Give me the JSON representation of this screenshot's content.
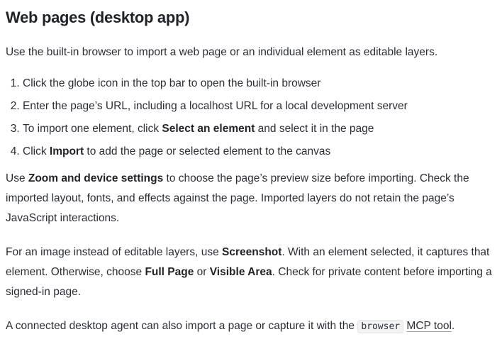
{
  "heading": "Web pages (desktop app)",
  "intro": "Use the built-in browser to import a web page or an individual element as editable layers.",
  "steps": [
    {
      "text": "Click the globe icon in the top bar to open the built-in browser"
    },
    {
      "text": "Enter the page’s URL, including a localhost URL for a local development server"
    },
    {
      "before": "To import one element, click ",
      "bold": "Select an element",
      "after": " and select it in the page"
    },
    {
      "before": "Click ",
      "bold": "Import",
      "after": " to add the page or selected element to the canvas"
    }
  ],
  "zoom_para": {
    "before": "Use ",
    "bold": "Zoom and device settings",
    "after": " to choose the page’s preview size before importing. Check the imported layout, fonts, and effects against the page. Imported layers do not retain the page’s JavaScript interactions."
  },
  "screenshot_para": {
    "t1": "For an image instead of editable layers, use ",
    "b1": "Screenshot",
    "t2": ". With an element selected, it captures that element. Otherwise, choose ",
    "b2": "Full Page",
    "t3": " or ",
    "b3": "Visible Area",
    "t4": ". Check for private content before importing a signed-in page."
  },
  "agent_para": {
    "before": "A connected desktop agent can also import a page or capture it with the ",
    "code": "browser",
    "link": "MCP tool",
    "after": "."
  }
}
